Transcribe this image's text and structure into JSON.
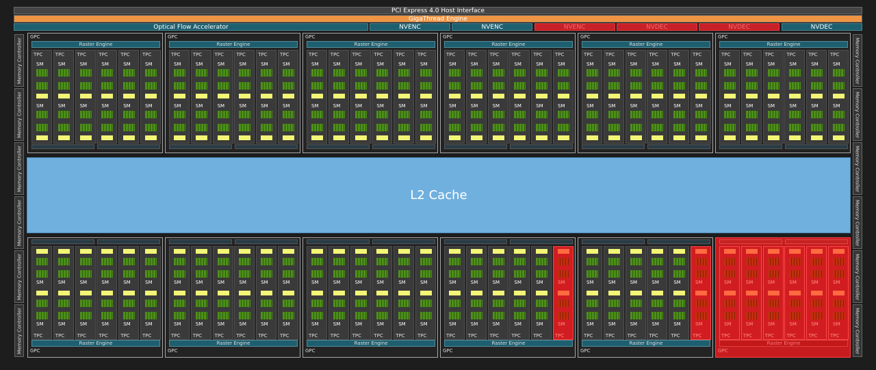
{
  "header": {
    "pcie_label": "PCI Express 4.0 Host Interface",
    "gigathread_label": "GigaThread Engine",
    "optical_flow_label": "Optical Flow Accelerator",
    "accelerators": [
      {
        "label": "NVENC",
        "enabled": true
      },
      {
        "label": "NVENC",
        "enabled": true
      },
      {
        "label": "NVENC",
        "enabled": false
      },
      {
        "label": "NVDEC",
        "enabled": false
      },
      {
        "label": "NVDEC",
        "enabled": false
      },
      {
        "label": "NVDEC",
        "enabled": true
      }
    ]
  },
  "memory_controller_label": "Memory Controller",
  "memory_controllers": {
    "left_count": 6,
    "right_count": 6
  },
  "l2_cache_label": "L2 Cache",
  "labels": {
    "gpc": "GPC",
    "tpc": "TPC",
    "sm": "SM",
    "raster_engine": "Raster Engine"
  },
  "gpcs": [
    {
      "row": "top",
      "disabled_tpcs": [],
      "enabled": true
    },
    {
      "row": "top",
      "disabled_tpcs": [],
      "enabled": true
    },
    {
      "row": "top",
      "disabled_tpcs": [],
      "enabled": true
    },
    {
      "row": "top",
      "disabled_tpcs": [],
      "enabled": true
    },
    {
      "row": "top",
      "disabled_tpcs": [],
      "enabled": true
    },
    {
      "row": "top",
      "disabled_tpcs": [],
      "enabled": true
    },
    {
      "row": "bottom",
      "disabled_tpcs": [],
      "enabled": true
    },
    {
      "row": "bottom",
      "disabled_tpcs": [],
      "enabled": true
    },
    {
      "row": "bottom",
      "disabled_tpcs": [],
      "enabled": true
    },
    {
      "row": "bottom",
      "disabled_tpcs": [
        6
      ],
      "enabled": true
    },
    {
      "row": "bottom",
      "disabled_tpcs": [
        6
      ],
      "enabled": true
    },
    {
      "row": "bottom",
      "disabled_tpcs": [
        1,
        2,
        3,
        4,
        5,
        6
      ],
      "enabled": false
    }
  ],
  "tpcs_per_gpc": 6,
  "colors": {
    "background": "#1d1d1d",
    "l2_cache": "#70b0df",
    "gigathread": "#ee9443",
    "accelerator": "#1e5f6f",
    "disabled": "#c61c20",
    "sm_core": "#4e8f1a",
    "sm_cache": "#f2f575"
  }
}
